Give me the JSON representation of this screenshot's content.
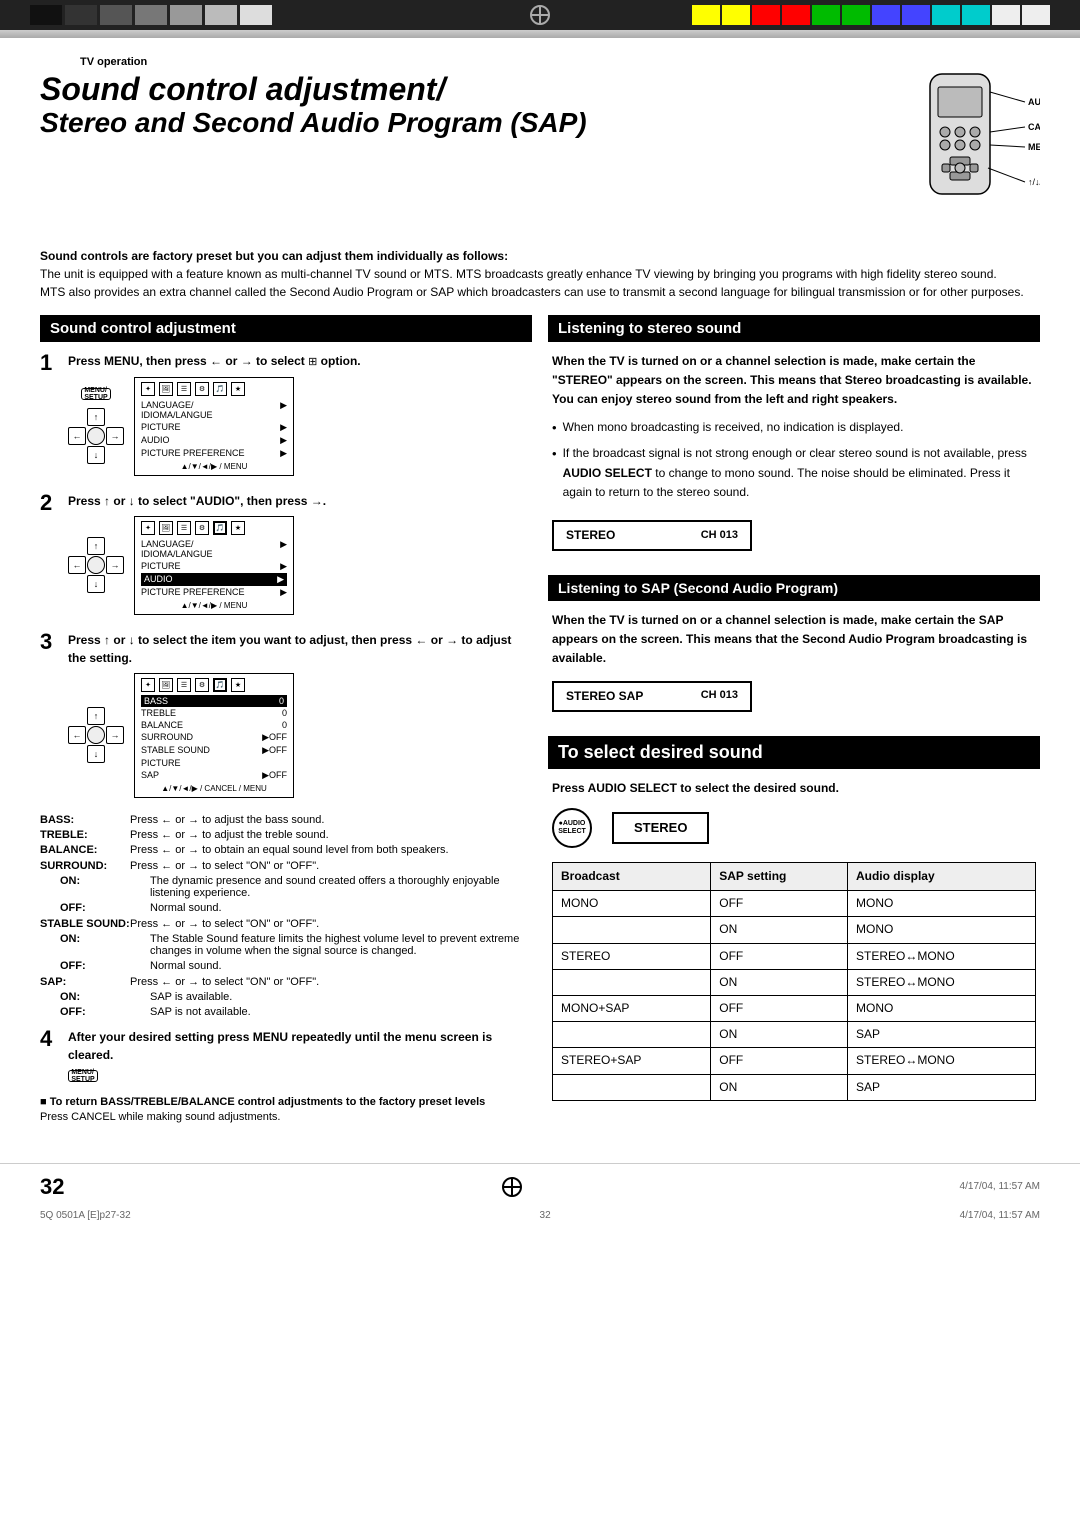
{
  "topBar": {
    "colors": [
      "#1a1a1a",
      "#333",
      "#555",
      "#777",
      "#999",
      "#bbb",
      "#ddd",
      "#fff",
      "#ff0",
      "#ff0",
      "#f00",
      "#f00",
      "#0f0",
      "#0f0",
      "#00f",
      "#00f",
      "#0ff",
      "#0ff",
      "#fff",
      "#fff"
    ]
  },
  "header": {
    "tvOperation": "TV operation"
  },
  "title": {
    "main": "Sound control adjustment/",
    "sub": "Stereo and Second Audio Program (SAP)"
  },
  "remoteLabels": {
    "audioSelect": "AUDIO SELECT",
    "cancel": "CANCEL",
    "menu": "MENU",
    "arrows": "↑/↓/←/→"
  },
  "intro": {
    "boldText": "Sound controls are factory preset but you can adjust them individually as follows:",
    "para1": "The unit is equipped with a feature known as multi-channel TV sound or MTS. MTS broadcasts greatly enhance TV viewing by bringing you programs with high fidelity stereo sound.",
    "para2": "MTS also provides an extra channel called the Second Audio Program or SAP which broadcasters can use to transmit a second language for bilingual transmission or for other purposes."
  },
  "soundControl": {
    "header": "Sound control adjustment",
    "step1": {
      "number": "1",
      "text": "Press MENU, then press ← or → to select",
      "text2": "option."
    },
    "step2": {
      "number": "2",
      "text": "Press ↑ or ↓ to select \"AUDIO\", then press →."
    },
    "step3": {
      "number": "3",
      "text": "Press ↑ or ↓ to select the item you want to adjust, then press ← or → to adjust the setting."
    },
    "menuItems": {
      "language": "LANGUAGE/IDIOMA/LANGUE",
      "picture": "PICTURE",
      "audio": "AUDIO",
      "picturePreference": "PICTURE PREFERENCE"
    },
    "menuItemsAudio": {
      "bass": "BASS",
      "treble": "TREBLE",
      "balance": "BALANCE",
      "surround": "SURROUND",
      "stableSound": "STABLE SOUND",
      "sap": "SAP"
    },
    "labels": {
      "bass": {
        "key": "BASS:",
        "val": "Press ← or → to adjust the bass sound."
      },
      "treble": {
        "key": "TREBLE:",
        "val": "Press ← or → to adjust the treble sound."
      },
      "balance": {
        "key": "BALANCE:",
        "val": "Press ← or → to obtain an equal sound level from both speakers."
      },
      "surround": {
        "key": "SURROUND:",
        "val": "Press ← or → to select \"ON\" or \"OFF\"."
      },
      "surroundOn": {
        "key": "ON:",
        "val": "The dynamic presence and sound created offers a thoroughly enjoyable listening experience."
      },
      "surroundOff": {
        "key": "OFF:",
        "val": "Normal sound."
      },
      "stableSound": {
        "key": "STABLE SOUND:",
        "val": "Press ← or → to select \"ON\" or \"OFF\"."
      },
      "stableSoundOn": {
        "key": "ON:",
        "val": "The Stable Sound feature limits the highest volume level to prevent extreme changes in volume when the signal source is changed."
      },
      "stableSoundOff": {
        "key": "OFF:",
        "val": "Normal sound."
      },
      "sap": {
        "key": "SAP:",
        "val": "Press ← or → to select \"ON\" or \"OFF\"."
      },
      "sapOn": {
        "key": "ON:",
        "val": "SAP is available."
      },
      "sapOff": {
        "key": "OFF:",
        "val": "SAP is not available."
      }
    },
    "step4": {
      "number": "4",
      "text": "After your desired setting press MENU repeatedly until the menu screen is cleared."
    },
    "note": {
      "bold": "■ To return BASS/TREBLE/BALANCE control adjustments to the factory preset levels",
      "text": "Press CANCEL while making sound adjustments."
    }
  },
  "listeningToStereo": {
    "header": "Listening to stereo sound",
    "body": "When the TV is turned on or a channel selection is made, make certain the \"STEREO\" appears on the screen. This means that Stereo broadcasting is available. You can enjoy stereo sound from the left and right speakers.",
    "bullet1": "When mono broadcasting is received, no indication is displayed.",
    "bullet2": "If the broadcast signal is not strong enough or clear stereo sound is not available, press AUDIO SELECT to change to mono sound. The noise should be eliminated. Press it again to return to the stereo sound.",
    "display": {
      "stereo": "STEREO",
      "ch": "CH 013"
    }
  },
  "listeningToSAP": {
    "header": "Listening to SAP (Second Audio Program)",
    "body": "When the TV is turned on or a channel selection is made, make certain the SAP appears on the screen. This means that the Second Audio Program broadcasting is available.",
    "display": {
      "stereoSap": "STEREO  SAP",
      "ch": "CH 013"
    }
  },
  "selectDesiredSound": {
    "header": "To select desired sound",
    "instruction": "Press AUDIO SELECT to select the desired sound.",
    "audioLabel": "AUDIO\nSELECT",
    "displayValue": "STEREO",
    "table": {
      "headers": [
        "Broadcast",
        "SAP setting",
        "Audio display"
      ],
      "rows": [
        {
          "broadcast": "MONO",
          "sap": "OFF",
          "audio": "MONO"
        },
        {
          "broadcast": "",
          "sap": "ON",
          "audio": "MONO"
        },
        {
          "broadcast": "STEREO",
          "sap": "OFF",
          "audio": "STEREO↔MONO"
        },
        {
          "broadcast": "",
          "sap": "ON",
          "audio": "STEREO↔MONO"
        },
        {
          "broadcast": "MONO+SAP",
          "sap": "OFF",
          "audio": "MONO"
        },
        {
          "broadcast": "",
          "sap": "ON",
          "audio": "SAP"
        },
        {
          "broadcast": "STEREO+SAP",
          "sap": "OFF",
          "audio": "STEREO↔MONO"
        },
        {
          "broadcast": "",
          "sap": "ON",
          "audio": "SAP"
        }
      ]
    }
  },
  "footer": {
    "pageNumber": "32",
    "leftCode": "5Q 0501A [E]p27-32",
    "centerPage": "32",
    "rightDate": "4/17/04, 11:57 AM"
  }
}
